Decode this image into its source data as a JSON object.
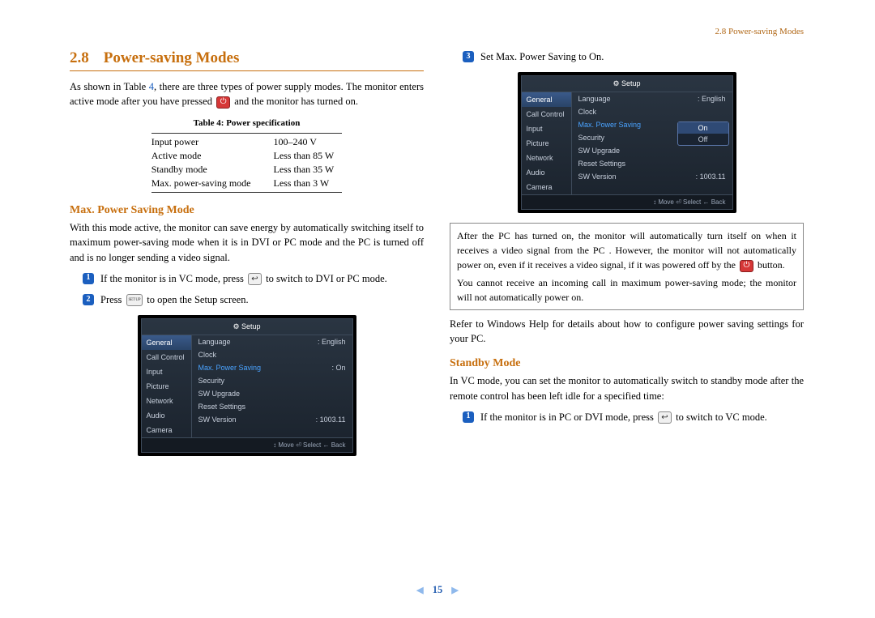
{
  "header": {
    "running": "2.8 Power-saving Modes"
  },
  "pageNumber": "15",
  "section": {
    "number": "2.8",
    "title": "Power-saving Modes",
    "intro_a": "As shown in Table ",
    "intro_link": "4",
    "intro_b": ", there are three types of power supply modes. The monitor enters active mode after you have pressed ",
    "intro_c": " and the monitor has turned on."
  },
  "table": {
    "caption": "Table 4: Power specification",
    "rows": [
      {
        "k": "Input power",
        "v": "100–240 V"
      },
      {
        "k": "Active mode",
        "v": "Less than 85 W"
      },
      {
        "k": "Standby mode",
        "v": "Less than 35 W"
      },
      {
        "k": "Max. power-saving mode",
        "v": "Less than 3 W"
      }
    ]
  },
  "maxPower": {
    "heading": "Max. Power Saving Mode",
    "para": "With this mode active, the monitor can save energy by automatically switching itself to maximum power-saving mode when it is in DVI or PC mode and the PC is turned off and is no longer sending a video signal.",
    "steps": [
      {
        "a": "If the monitor is in VC mode, press ",
        "b": " to switch to DVI or PC mode."
      },
      {
        "a": "Press ",
        "b": " to open the Setup screen."
      },
      {
        "a": "Set Max. Power Saving to On.",
        "b": ""
      }
    ]
  },
  "osd1": {
    "title": "Setup",
    "tabs": [
      "General",
      "Call Control",
      "Input",
      "Picture",
      "Network",
      "Audio",
      "Camera"
    ],
    "rows": [
      {
        "k": "Language",
        "v": "English",
        "hl": false
      },
      {
        "k": "Clock",
        "v": "",
        "hl": false
      },
      {
        "k": "Max. Power Saving",
        "v": "On",
        "hl": true
      },
      {
        "k": "Security",
        "v": "",
        "hl": false
      },
      {
        "k": "SW Upgrade",
        "v": "",
        "hl": false
      },
      {
        "k": "Reset Settings",
        "v": "",
        "hl": false
      },
      {
        "k": "SW Version",
        "v": "1003.11",
        "hl": false
      }
    ],
    "footer": "↕ Move   ⏎ Select   ← Back"
  },
  "osd2": {
    "title": "Setup",
    "tabs": [
      "General",
      "Call Control",
      "Input",
      "Picture",
      "Network",
      "Audio",
      "Camera"
    ],
    "rows": [
      {
        "k": "Language",
        "v": "English",
        "hl": false
      },
      {
        "k": "Clock",
        "v": "",
        "hl": false
      },
      {
        "k": "Max. Power Saving",
        "v": "",
        "hl": true
      },
      {
        "k": "Security",
        "v": "",
        "hl": false
      },
      {
        "k": "SW Upgrade",
        "v": "",
        "hl": false
      },
      {
        "k": "Reset Settings",
        "v": "",
        "hl": false
      },
      {
        "k": "SW Version",
        "v": "1003.11",
        "hl": false
      }
    ],
    "dropdown": {
      "options": [
        "On",
        "Off"
      ],
      "selected": "On"
    },
    "footer": "↕ Move   ⏎ Select   ← Back"
  },
  "note": {
    "p1a": "After the PC has turned on, the monitor will automatically turn itself on when it receives a video signal from the PC . However, the monitor will not automatically power on, even if it receives a video signal, if it was powered off by the ",
    "p1b": " button.",
    "p2": "You cannot receive an incoming call in maximum power-saving mode; the monitor will not automatically power on."
  },
  "afterNote": "Refer to Windows Help for details about how to configure power saving settings for your PC.",
  "standby": {
    "heading": "Standby Mode",
    "para": "In VC mode, you can set the monitor to automatically switch to standby mode after the remote control has been left idle for a specified time:",
    "step1a": "If the monitor is in PC or DVI mode, press ",
    "step1b": " to switch to VC mode."
  },
  "icons": {
    "power": "⏻",
    "switch": "↩",
    "setup": "SET UP"
  }
}
